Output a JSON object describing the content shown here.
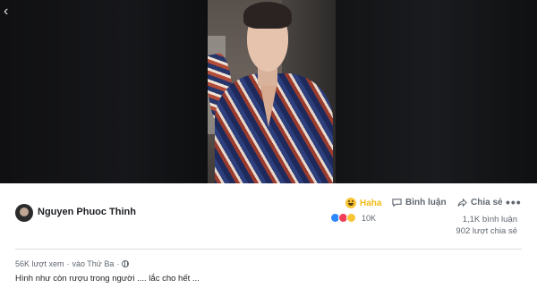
{
  "video": {
    "back_icon": "chevron-left-icon"
  },
  "post": {
    "page_name": "Nguyen Phuoc Thinh",
    "actions": {
      "haha_label": "Haha",
      "comment_label": "Bình luận",
      "share_label": "Chia sẻ",
      "more_label": "•••"
    },
    "reactions": {
      "types": [
        "like",
        "love",
        "haha"
      ],
      "count": "10K"
    },
    "stats": {
      "comments": "1,1K bình luận",
      "shares": "902 lượt chia sẻ"
    },
    "meta": {
      "views": "56K lượt xem",
      "separator": "·",
      "time": "vào Thứ Ba",
      "separator2": "·"
    },
    "caption": "Hình như còn rượu trong người .... lắc cho hết ..."
  }
}
